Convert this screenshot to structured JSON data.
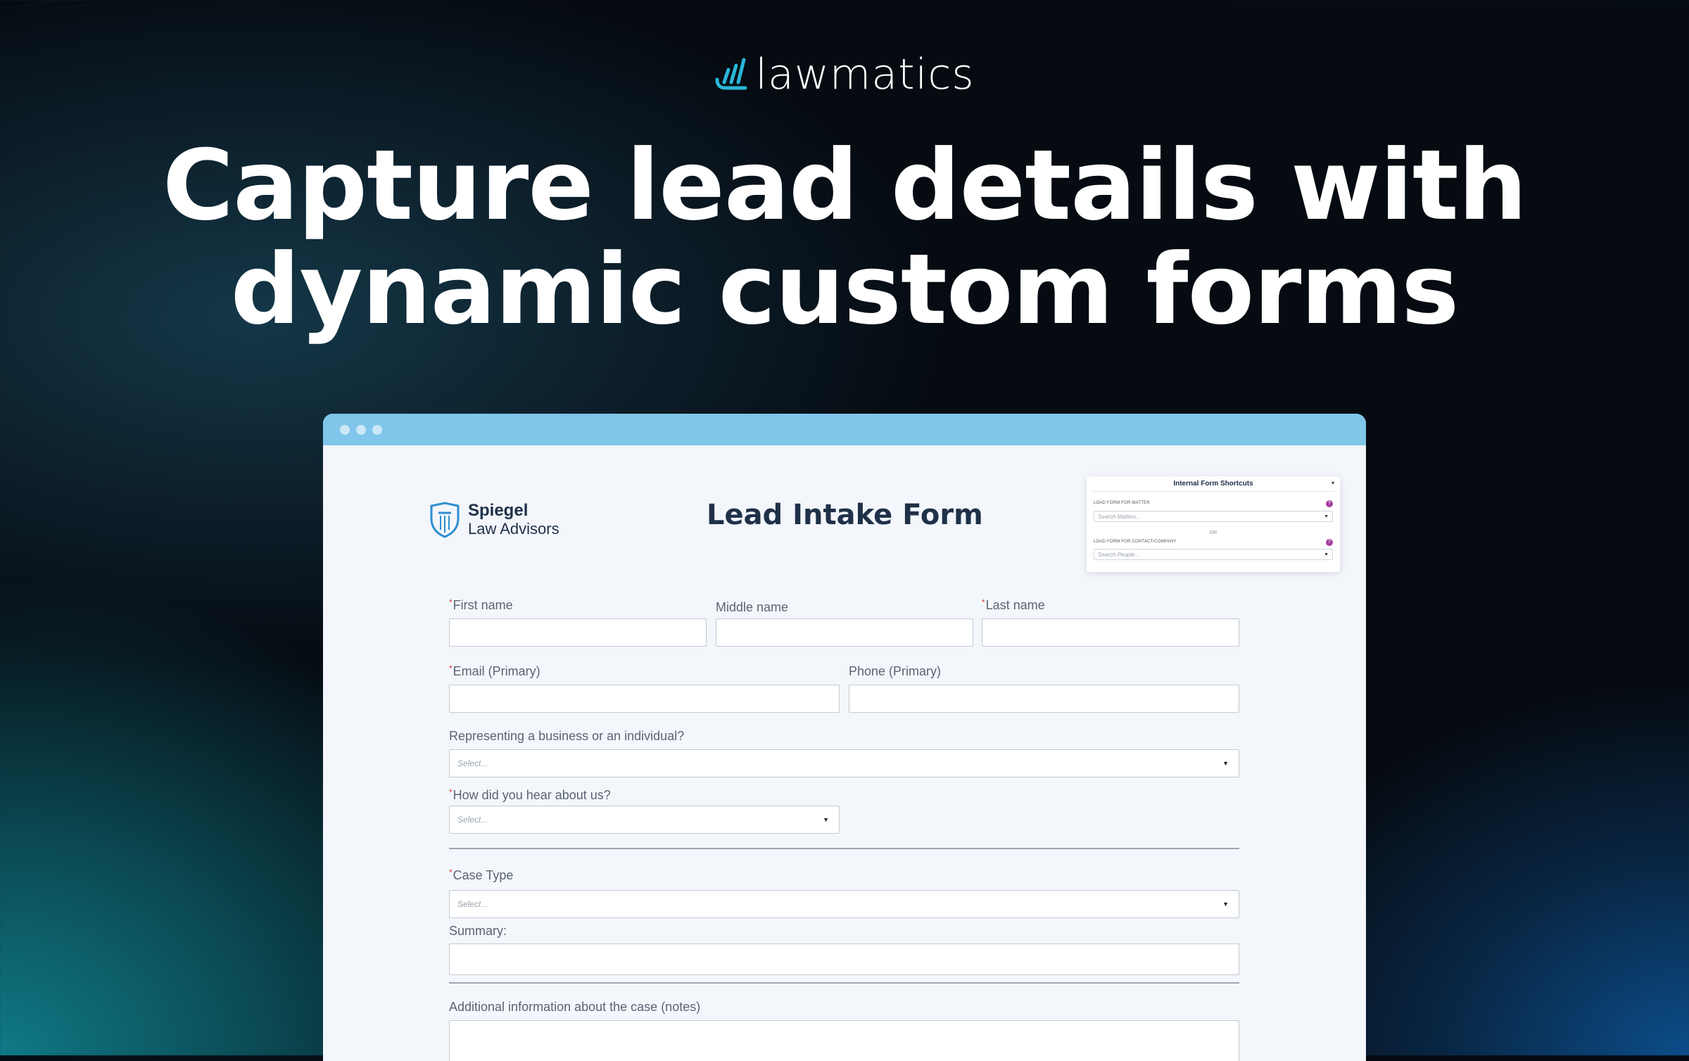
{
  "brand": {
    "name": "lawmatics",
    "accent": "#29b6d6"
  },
  "hero": {
    "line1": "Capture lead details with",
    "line2": "dynamic custom forms"
  },
  "browser": {
    "bar_color": "#7fc6ea"
  },
  "firm": {
    "name": "Spiegel",
    "subtitle": "Law Advisors"
  },
  "form": {
    "title": "Lead Intake Form",
    "shortcuts": {
      "title": "Internal Form Shortcuts",
      "matter_label": "LOAD FORM FOR MATTER",
      "matter_placeholder": "Search Matters...",
      "or": "OR",
      "contact_label": "LOAD FORM FOR CONTACT/COMPANY",
      "contact_placeholder": "Search People..."
    },
    "fields": {
      "first_name": "First name",
      "middle_name": "Middle name",
      "last_name": "Last name",
      "email": "Email (Primary)",
      "phone": "Phone (Primary)",
      "representing": "Representing a business or an individual?",
      "hear_about": "How did you hear about us?",
      "case_type": "Case Type",
      "summary": "Summary:",
      "notes": "Additional information about the case (notes)"
    },
    "select_placeholder": "Select...",
    "required_mark": "*"
  }
}
